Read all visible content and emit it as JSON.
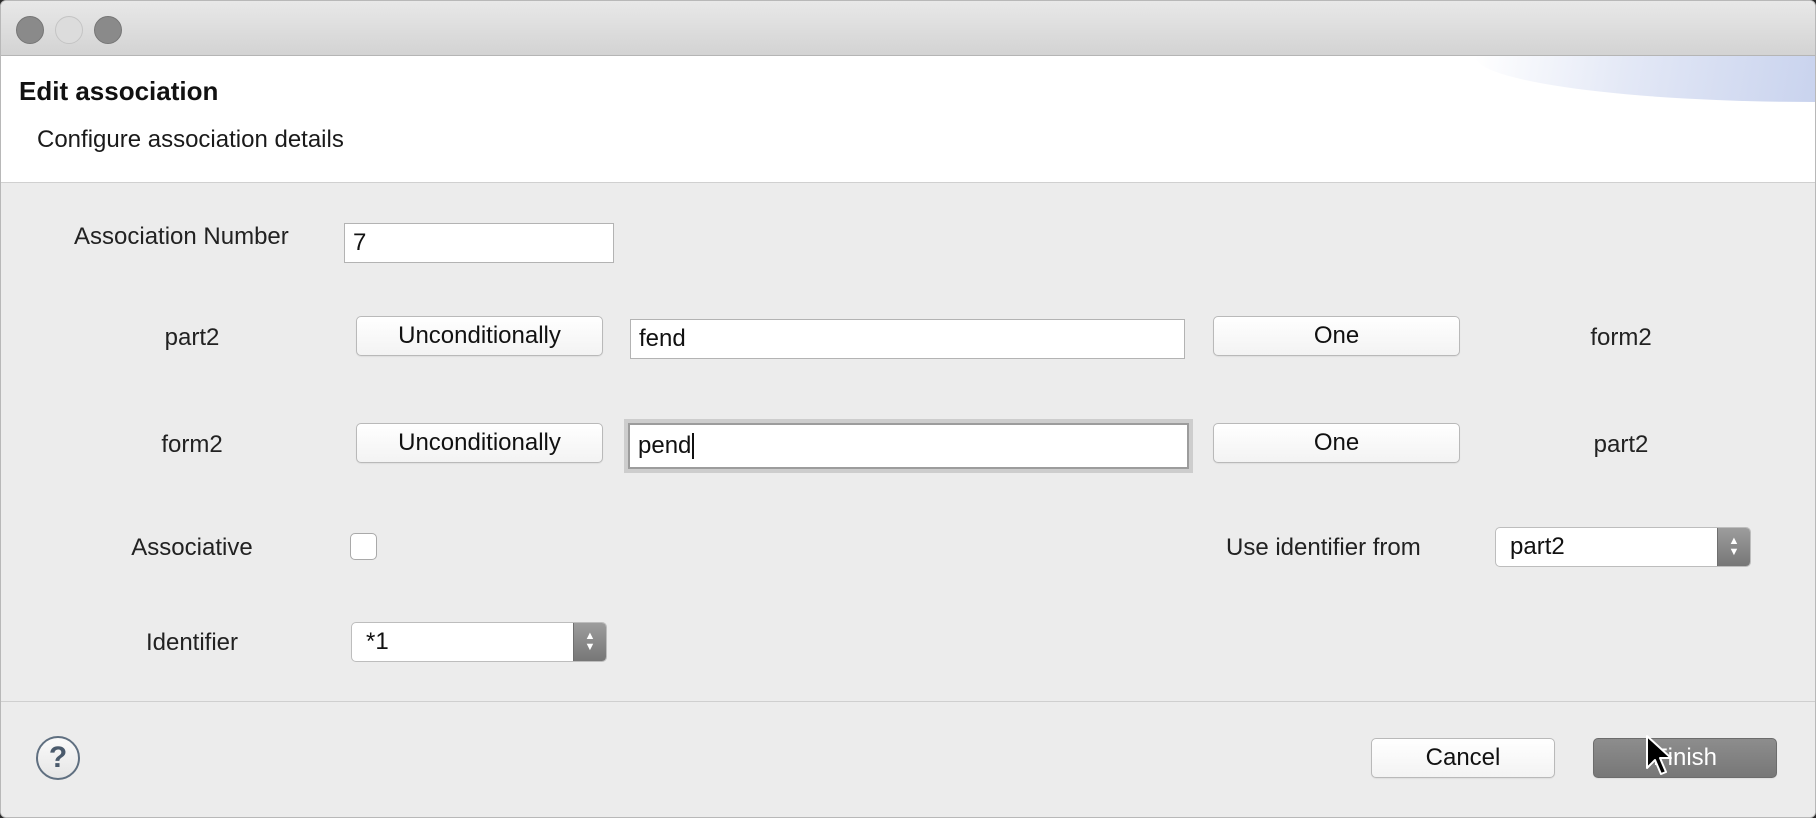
{
  "dialog": {
    "title": "Edit association",
    "subtitle": "Configure association details"
  },
  "form": {
    "association_number_label": "Association Number",
    "association_number_value": "7",
    "row1": {
      "left_label": "part2",
      "condition_button": "Unconditionally",
      "phrase_value": "fend",
      "multiplicity_button": "One",
      "right_label": "form2"
    },
    "row2": {
      "left_label": "form2",
      "condition_button": "Unconditionally",
      "phrase_value": "pend",
      "multiplicity_button": "One",
      "right_label": "part2"
    },
    "associative_label": "Associative",
    "associative_checked": false,
    "use_identifier_label": "Use identifier from",
    "use_identifier_value": "part2",
    "identifier_label": "Identifier",
    "identifier_value": "*1"
  },
  "footer": {
    "help_icon": "?",
    "cancel_label": "Cancel",
    "finish_label": "Finish"
  },
  "colors": {
    "window_bg": "#ececec",
    "primary_button": "#808080",
    "banner_bg": "#ffffff"
  }
}
